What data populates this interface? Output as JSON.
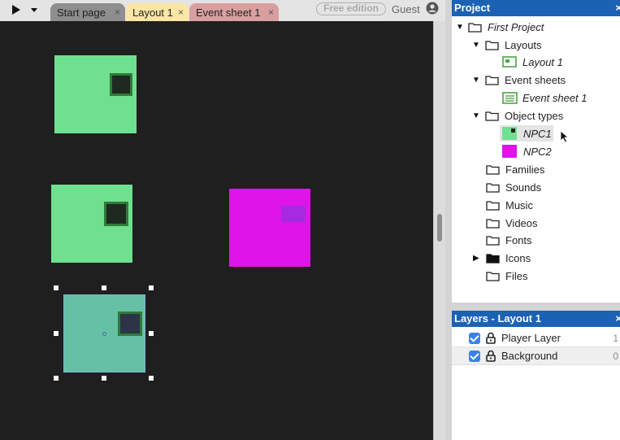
{
  "toolbar": {
    "play_icon": "play-icon",
    "dropdown_icon": "chevron-down-icon"
  },
  "tabs": [
    {
      "label": "Start page",
      "close": "×",
      "color": "#8e8e8e"
    },
    {
      "label": "Layout 1",
      "close": "×",
      "color": "#fbe6a6",
      "active": true
    },
    {
      "label": "Event sheet 1",
      "close": "×",
      "color": "#d99f9f"
    }
  ],
  "header": {
    "edition": "Free edition",
    "user": "Guest",
    "user_icon": "user-circle-icon"
  },
  "layout_canvas": {
    "background": "#1f1f1f",
    "sprites": [
      {
        "name": "NPC1",
        "color": "#6ee08f",
        "eye_color": "#1e2a1f"
      },
      {
        "name": "NPC1",
        "color": "#6ee08f",
        "eye_color": "#1e2a1f"
      },
      {
        "name": "NPC2",
        "color": "#de14e8",
        "eye_color": "#a62ae0"
      },
      {
        "name": "NPC1",
        "color": "#66c0a6",
        "eye_color": "#2d3348",
        "selected": true
      }
    ]
  },
  "project": {
    "title": "Project",
    "close": "×",
    "root": "First Project",
    "layouts_folder": "Layouts",
    "layout_item": "Layout 1",
    "events_folder": "Event sheets",
    "event_item": "Event sheet 1",
    "objects_folder": "Object types",
    "objects": [
      {
        "label": "NPC1",
        "color": "#6ee08f"
      },
      {
        "label": "NPC2",
        "color": "#de14e8"
      }
    ],
    "folders": [
      "Families",
      "Sounds",
      "Music",
      "Videos",
      "Fonts",
      "Icons",
      "Files"
    ]
  },
  "layers": {
    "title": "Layers - Layout 1",
    "close": "×",
    "items": [
      {
        "label": "Player Layer",
        "visible": true,
        "extra": "1"
      },
      {
        "label": "Background",
        "visible": true,
        "extra": "0"
      }
    ]
  },
  "colors": {
    "panel_header": "#1b62b5",
    "checkbox": "#3b82e6",
    "accent_green": "#4ea346"
  }
}
